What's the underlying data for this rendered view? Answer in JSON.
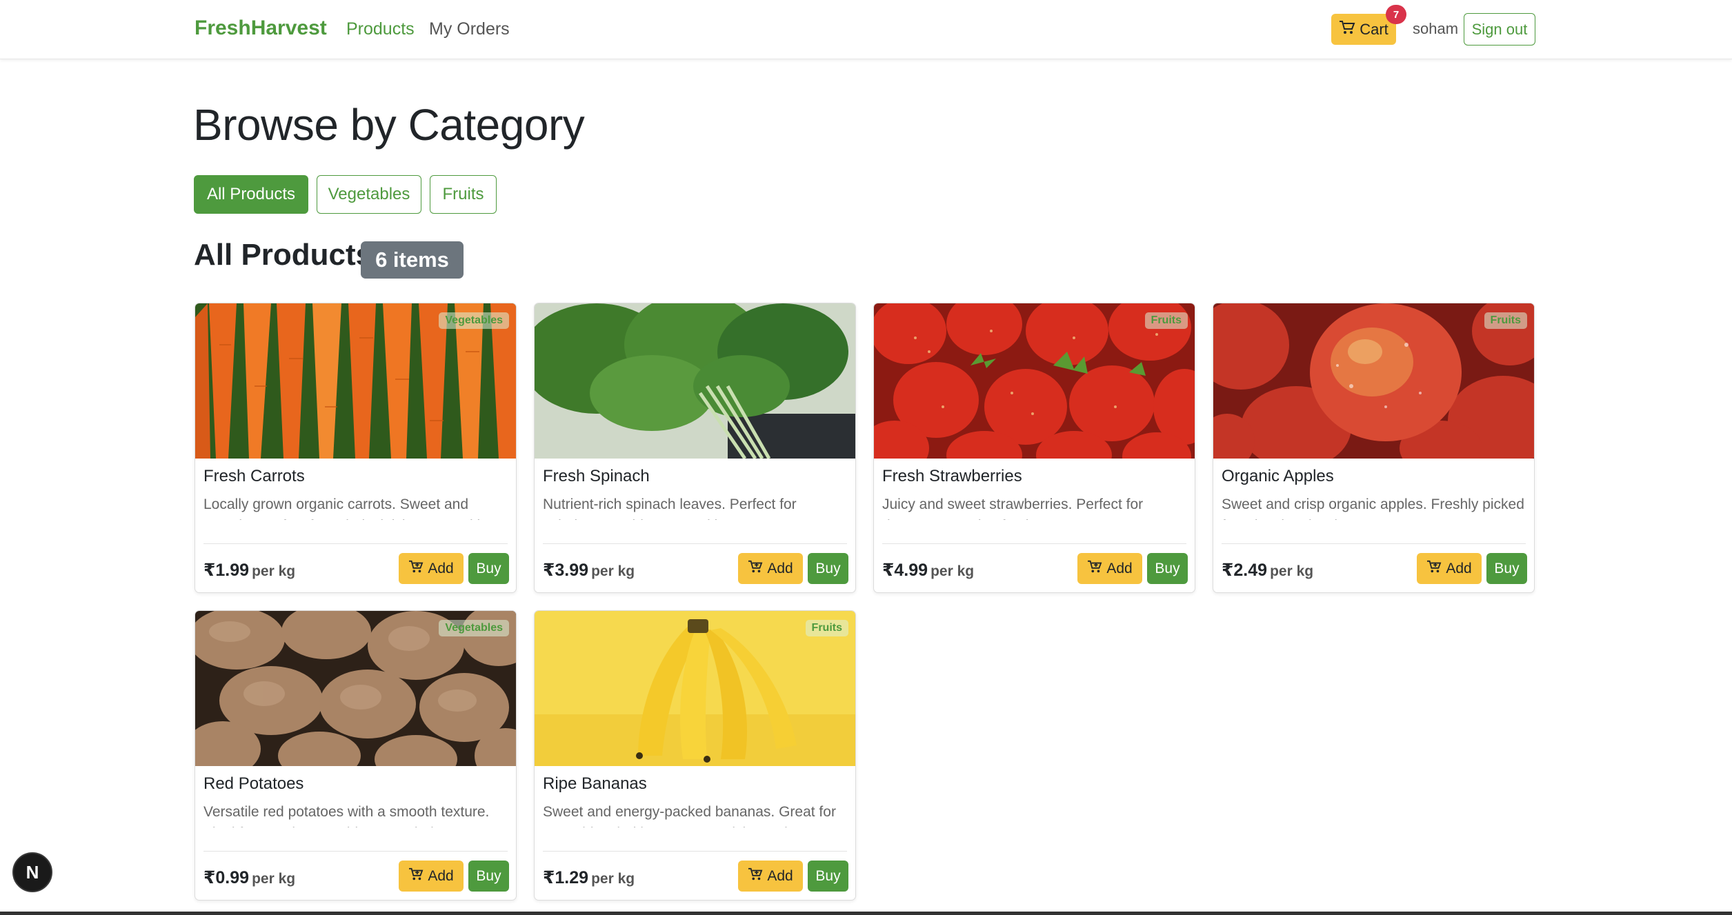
{
  "navbar": {
    "brand": "FreshHarvest",
    "links": [
      "Products",
      "My Orders"
    ],
    "cart_label": "Cart",
    "cart_count": "7",
    "username": "soham",
    "signout_label": "Sign out"
  },
  "page": {
    "title": "Browse by Category",
    "filters": [
      "All Products",
      "Vegetables",
      "Fruits"
    ],
    "active_filter": "All Products",
    "section_title": "All Products",
    "item_count": "6 items"
  },
  "buttons": {
    "add": "Add",
    "buy": "Buy"
  },
  "products": [
    {
      "name": "Fresh Carrots",
      "category": "Vegetables",
      "description": "Locally grown organic carrots. Sweet and crunchy, perfect for salads, juicing, or cooking.",
      "price": "₹1.99",
      "unit": "per kg"
    },
    {
      "name": "Fresh Spinach",
      "category": "",
      "description": "Nutrient-rich spinach leaves. Perfect for salads, smoothies, or cooking.",
      "price": "₹3.99",
      "unit": "per kg"
    },
    {
      "name": "Fresh Strawberries",
      "category": "Fruits",
      "description": "Juicy and sweet strawberries. Perfect for desserts or eating fresh.",
      "price": "₹4.99",
      "unit": "per kg"
    },
    {
      "name": "Organic Apples",
      "category": "Fruits",
      "description": "Sweet and crisp organic apples. Freshly picked from local orchards.",
      "price": "₹2.49",
      "unit": "per kg"
    },
    {
      "name": "Red Potatoes",
      "category": "Vegetables",
      "description": "Versatile red potatoes with a smooth texture. Ideal for roasting, mashing, or salads.",
      "price": "₹0.99",
      "unit": "per kg"
    },
    {
      "name": "Ripe Bananas",
      "category": "Fruits",
      "description": "Sweet and energy-packed bananas. Great for smoothies, baking, or as a quick snack.",
      "price": "₹1.29",
      "unit": "per kg"
    }
  ],
  "dev_badge": "N",
  "colors": {
    "brand": "#4e9a3e",
    "warning": "#f7c33f",
    "badge_gray": "#6c757d",
    "danger": "#d9334a"
  }
}
